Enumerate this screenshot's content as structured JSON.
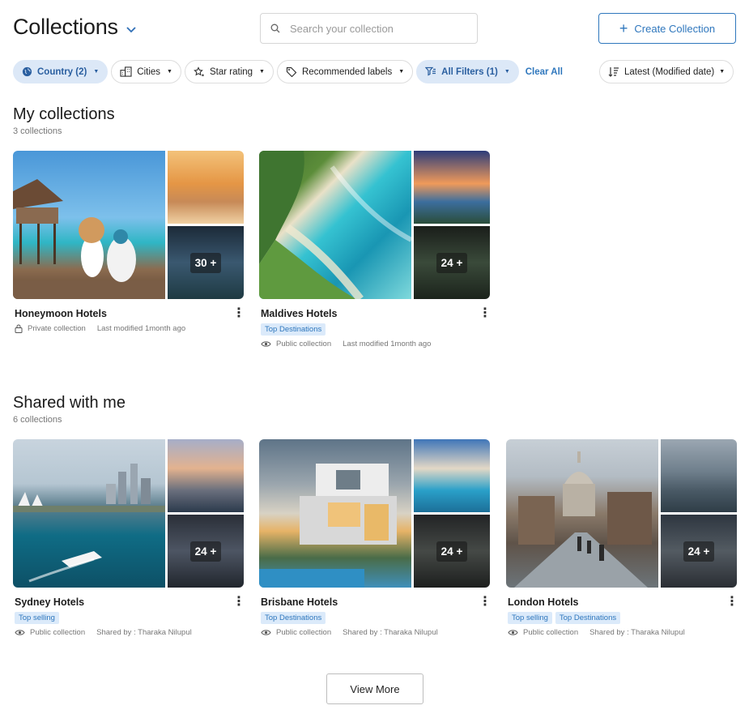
{
  "header": {
    "title": "Collections",
    "search_placeholder": "Search your collection",
    "create_label": "Create Collection"
  },
  "filters": {
    "chips": [
      {
        "label": "Country (2)",
        "icon": "globe-icon",
        "active": true
      },
      {
        "label": "Cities",
        "icon": "city-icon",
        "active": false
      },
      {
        "label": "Star rating",
        "icon": "star-rating-icon",
        "active": false
      },
      {
        "label": "Recommended labels",
        "icon": "tag-icon",
        "active": false
      },
      {
        "label": "All Filters (1)",
        "icon": "filter-icon",
        "active": true
      }
    ],
    "clear_all": "Clear All",
    "sort_label": "Latest (Modified date)"
  },
  "my_collections": {
    "title": "My collections",
    "count": "3 collections",
    "cards": [
      {
        "name": "Honeymoon Hotels",
        "tags": [],
        "visibility": "Private collection",
        "meta": "Last modified 1month ago",
        "badge": "30 +"
      },
      {
        "name": "Maldives Hotels",
        "tags": [
          "Top Destinations"
        ],
        "visibility": "Public collection",
        "meta": "Last modified 1month ago",
        "badge": "24 +"
      }
    ]
  },
  "shared": {
    "title": "Shared with me",
    "count": "6 collections",
    "cards": [
      {
        "name": "Sydney Hotels",
        "tags": [
          "Top selling"
        ],
        "visibility": "Public collection",
        "meta": "Shared by : Tharaka Nilupul",
        "badge": "24 +"
      },
      {
        "name": "Brisbane Hotels",
        "tags": [
          "Top Destinations"
        ],
        "visibility": "Public collection",
        "meta": "Shared by : Tharaka Nilupul",
        "badge": "24 +"
      },
      {
        "name": "London Hotels",
        "tags": [
          "Top selling",
          "Top Destinations"
        ],
        "visibility": "Public collection",
        "meta": "Shared by : Tharaka Nilupul",
        "badge": "24 +"
      }
    ]
  },
  "view_more": "View More",
  "colors": {
    "accent": "#2f77bd",
    "chip_active_bg": "#dce8f7",
    "tag_bg": "#dbeafa"
  }
}
